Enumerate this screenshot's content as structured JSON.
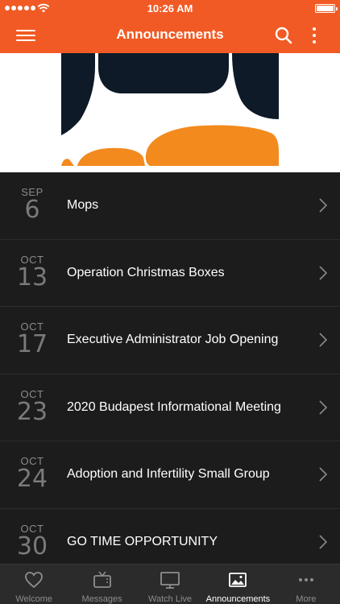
{
  "status_bar": {
    "time": "10:26 AM"
  },
  "header": {
    "title": "Announcements"
  },
  "announcements": [
    {
      "month": "SEP",
      "day": "6",
      "title": "Mops"
    },
    {
      "month": "OCT",
      "day": "13",
      "title": "Operation Christmas Boxes"
    },
    {
      "month": "OCT",
      "day": "17",
      "title": "Executive Administrator Job Opening"
    },
    {
      "month": "OCT",
      "day": "23",
      "title": "2020 Budapest Informational Meeting"
    },
    {
      "month": "OCT",
      "day": "24",
      "title": "Adoption and Infertility Small Group"
    },
    {
      "month": "OCT",
      "day": "30",
      "title": "GO TIME OPPORTUNITY"
    }
  ],
  "tabs": [
    {
      "label": "Welcome",
      "icon": "heart-icon"
    },
    {
      "label": "Messages",
      "icon": "tv-icon"
    },
    {
      "label": "Watch Live",
      "icon": "monitor-icon"
    },
    {
      "label": "Announcements",
      "icon": "image-icon",
      "active": true
    },
    {
      "label": "More",
      "icon": "more-dots-icon"
    }
  ],
  "colors": {
    "accent": "#f15a24",
    "banner_navy": "#0e1a28",
    "banner_orange": "#f28a1e",
    "list_bg": "#1c1c1c",
    "tabbar_bg": "#2b2b2b"
  }
}
